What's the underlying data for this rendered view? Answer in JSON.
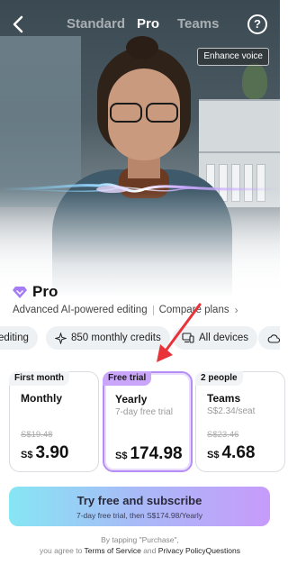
{
  "header": {
    "tabs": [
      {
        "label": "Standard",
        "active": false
      },
      {
        "label": "Pro",
        "active": true
      },
      {
        "label": "Teams",
        "active": false
      }
    ],
    "help_icon": "question-circle-icon",
    "back_icon": "chevron-left-icon"
  },
  "hero": {
    "enhance_label": "Enhance voice"
  },
  "pro": {
    "title": "Pro",
    "icon": "diamond-icon",
    "subtitle": "Advanced AI-powered editing",
    "compare_link": "Compare plans"
  },
  "features": [
    {
      "label": "editing",
      "icon": ""
    },
    {
      "label": "850 monthly credits",
      "icon": "sparkle-icon"
    },
    {
      "label": "All devices",
      "icon": "devices-icon"
    },
    {
      "label": "",
      "icon": "cloud-icon"
    }
  ],
  "plans": [
    {
      "badge": "First month",
      "name": "Monthly",
      "note": "",
      "original_price": "S$19.48",
      "currency": "S$",
      "price": "3.90",
      "selected": false
    },
    {
      "badge": "Free trial",
      "name": "Yearly",
      "note": "7-day free trial",
      "original_price": "",
      "currency": "S$",
      "price": "174.98",
      "selected": true
    },
    {
      "badge": "2 people",
      "name": "Teams",
      "note": "S$2.34/seat",
      "original_price": "S$23.46",
      "currency": "S$",
      "price": "4.68",
      "selected": false
    }
  ],
  "cta": {
    "label": "Try free and subscribe",
    "sublabel": "7-day free trial, then S$174.98/Yearly"
  },
  "legal": {
    "line1": "By tapping \"Purchase\",",
    "line2_prefix": "you agree to",
    "terms": "Terms of Service",
    "and": "and",
    "privacy": "Privacy Policy",
    "questions": "Questions"
  },
  "colors": {
    "accent_purple": "#b68df5",
    "cta_gradient_start": "#86e6f4",
    "cta_gradient_end": "#c79bfb",
    "arrow_red": "#e8333a"
  }
}
